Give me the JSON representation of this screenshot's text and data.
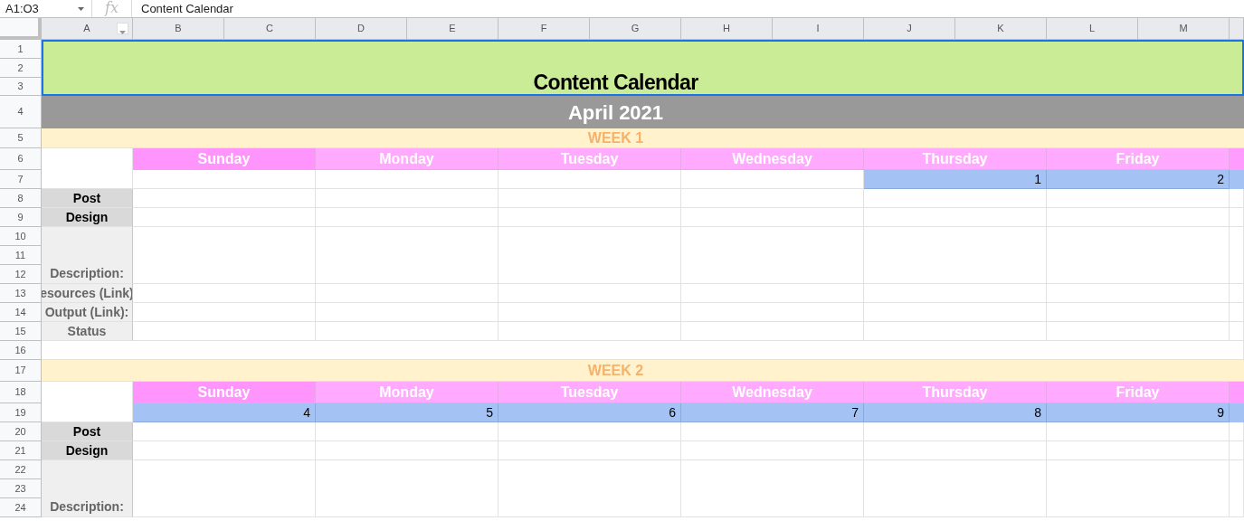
{
  "formula_bar": {
    "cell_ref": "A1:O3",
    "fx": "fx",
    "content": "Content Calendar"
  },
  "columns": [
    "A",
    "B",
    "C",
    "D",
    "E",
    "F",
    "G",
    "H",
    "I",
    "J",
    "K",
    "L",
    "M"
  ],
  "row_numbers": [
    "1",
    "2",
    "3",
    "4",
    "5",
    "6",
    "7",
    "8",
    "9",
    "10",
    "11",
    "12",
    "13",
    "14",
    "15",
    "16",
    "17",
    "18",
    "19",
    "20",
    "21",
    "22",
    "23",
    "24"
  ],
  "title": "Content Calendar",
  "month": "April 2021",
  "weeks": [
    {
      "label": "WEEK 1",
      "days": [
        {
          "name": "Sunday",
          "color": "#ff94fd"
        },
        {
          "name": "Monday",
          "color": "#ffaafe"
        },
        {
          "name": "Tuesday",
          "color": "#ffaafe"
        },
        {
          "name": "Wednesday",
          "color": "#ffaafe"
        },
        {
          "name": "Thursday",
          "color": "#ffaafe"
        },
        {
          "name": "Friday",
          "color": "#ffaafe"
        }
      ],
      "dates": [
        {
          "filled": false
        },
        {
          "filled": false
        },
        {
          "filled": false
        },
        {
          "filled": false
        },
        {
          "filled": true,
          "text": "1"
        },
        {
          "filled": true,
          "text": "2"
        }
      ],
      "fields": [
        {
          "label": "Post",
          "kind": "primary"
        },
        {
          "label": "Design",
          "kind": "primary"
        },
        {
          "label": "Description:",
          "kind": "tall"
        },
        {
          "label": "esources (Link)",
          "kind": "detail"
        },
        {
          "label": "Output (Link):",
          "kind": "detail"
        },
        {
          "label": "Status",
          "kind": "detail"
        }
      ]
    },
    {
      "label": "WEEK 2",
      "days": [
        {
          "name": "Sunday",
          "color": "#ff94fd"
        },
        {
          "name": "Monday",
          "color": "#ffaafe"
        },
        {
          "name": "Tuesday",
          "color": "#ffaafe"
        },
        {
          "name": "Wednesday",
          "color": "#ffaafe"
        },
        {
          "name": "Thursday",
          "color": "#ffaafe"
        },
        {
          "name": "Friday",
          "color": "#ffaafe"
        }
      ],
      "dates": [
        {
          "filled": true,
          "text": "4"
        },
        {
          "filled": true,
          "text": "5"
        },
        {
          "filled": true,
          "text": "6"
        },
        {
          "filled": true,
          "text": "7"
        },
        {
          "filled": true,
          "text": "8"
        },
        {
          "filled": true,
          "text": "9"
        }
      ],
      "fields": [
        {
          "label": "Post",
          "kind": "primary"
        },
        {
          "label": "Design",
          "kind": "primary"
        },
        {
          "label": "Description:",
          "kind": "tall"
        }
      ]
    }
  ]
}
